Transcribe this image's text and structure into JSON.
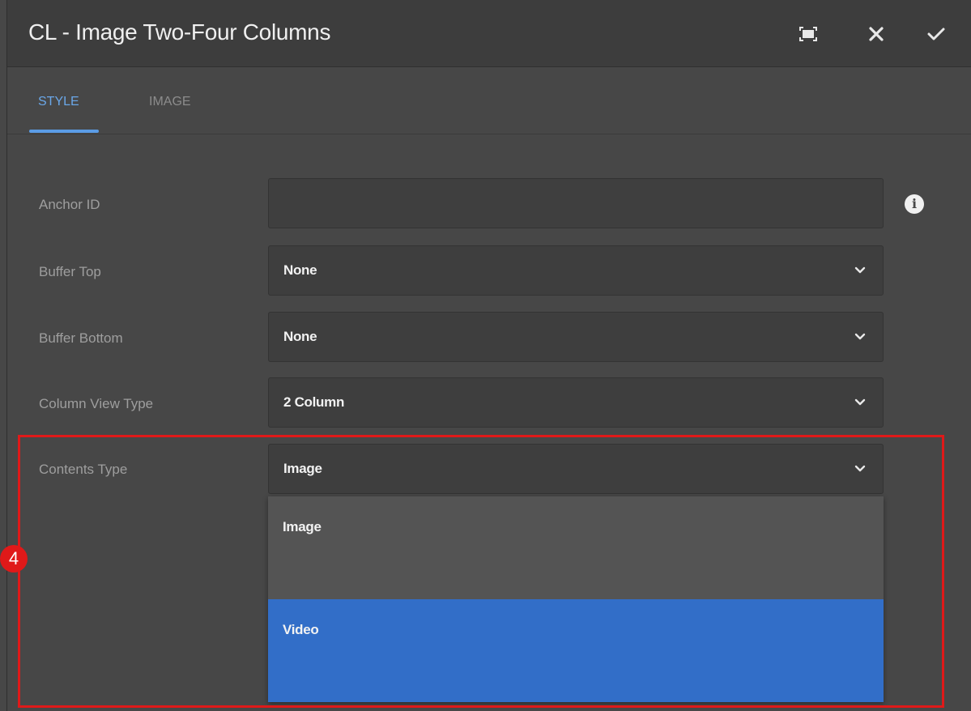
{
  "dialog": {
    "title": "CL - Image Two-Four Columns"
  },
  "toolbar": {
    "fullscreen_icon": "fullscreen-icon",
    "close_icon": "close-icon",
    "confirm_icon": "check-icon"
  },
  "tabs": [
    {
      "label": "STYLE",
      "active": true
    },
    {
      "label": "IMAGE",
      "active": false
    }
  ],
  "form": {
    "anchor_id": {
      "label": "Anchor ID",
      "value": ""
    },
    "buffer_top": {
      "label": "Buffer Top",
      "value": "None"
    },
    "buffer_bottom": {
      "label": "Buffer Bottom",
      "value": "None"
    },
    "column_view_type": {
      "label": "Column View Type",
      "value": "2 Column"
    },
    "contents_type": {
      "label": "Contents Type",
      "value": "Image",
      "options": [
        "Image",
        "Video"
      ],
      "highlighted_option": "Video"
    }
  },
  "annotation": {
    "step_number": "4"
  },
  "colors": {
    "accent": "#5b9ce6",
    "selected_option": "#326ec8",
    "annotation_red": "#e01919"
  }
}
